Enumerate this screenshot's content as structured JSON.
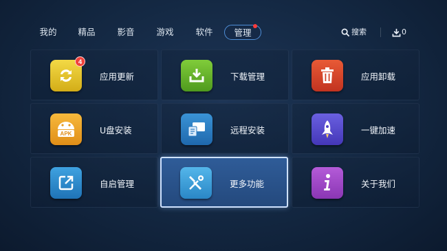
{
  "nav": {
    "tabs": [
      "我的",
      "精品",
      "影音",
      "游戏",
      "软件",
      "管理"
    ],
    "active_tab_index": 5,
    "search_label": "搜索",
    "download_count": "0"
  },
  "tiles": [
    {
      "label": "应用更新",
      "icon": "refresh-arrows-icon",
      "color": "#e3c52c",
      "badge": "4"
    },
    {
      "label": "下载管理",
      "icon": "download-tray-icon",
      "color": "#66b52a"
    },
    {
      "label": "应用卸载",
      "icon": "trash-can-icon",
      "color": "#d8452a"
    },
    {
      "label": "U盘安装",
      "icon": "apk-android-icon",
      "color": "#f0a52a"
    },
    {
      "label": "远程安装",
      "icon": "remote-devices-icon",
      "color": "#2c7fc4"
    },
    {
      "label": "一键加速",
      "icon": "rocket-icon",
      "color": "#5a4fd0"
    },
    {
      "label": "自启管理",
      "icon": "launch-square-icon",
      "color": "#2f8fd0"
    },
    {
      "label": "更多功能",
      "icon": "wrench-tools-icon",
      "color": "#3da2dc"
    },
    {
      "label": "关于我们",
      "icon": "info-icon",
      "color": "#a04ac8"
    }
  ],
  "focused_tile_index": 7,
  "colors": {
    "accent": "#4f8fd8",
    "notify_dot": "#ff3b3b",
    "badge": "#f0413a"
  }
}
